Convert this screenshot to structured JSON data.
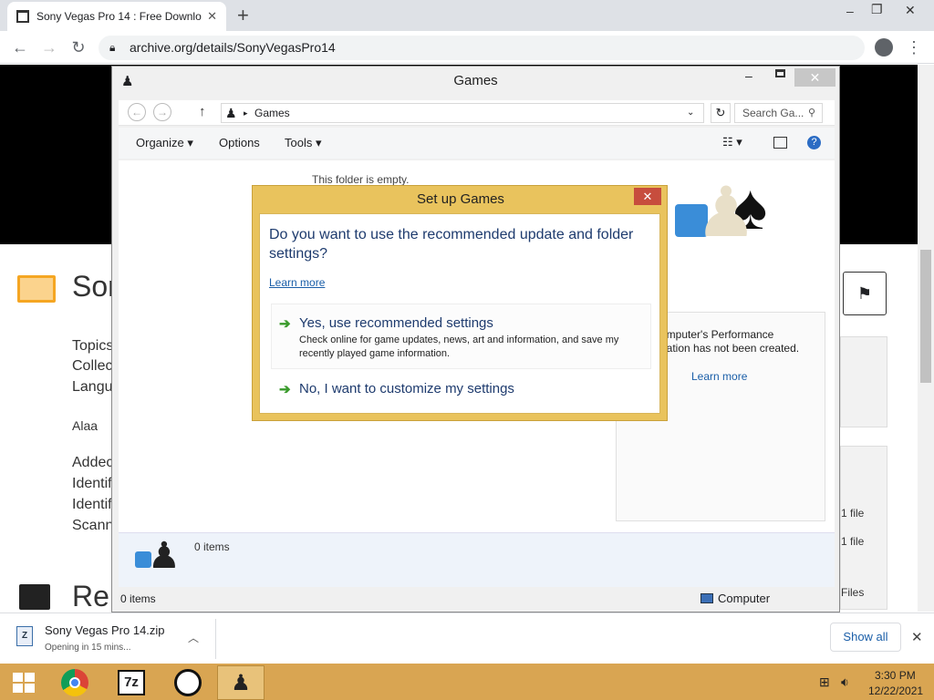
{
  "browser": {
    "tab_title": "Sony Vegas Pro 14 : Free Downlo",
    "new_tab": "+",
    "url": "archive.org/details/SonyVegasPro14",
    "window_controls": [
      "–",
      "❐",
      "✕"
    ]
  },
  "page": {
    "title_fragment": "Sor",
    "meta_labels": [
      "Topics",
      "Collec",
      "Langu",
      "Alaa",
      "Addec",
      "Identif",
      "Identif",
      "Scann"
    ],
    "reviews_fragment": "Re",
    "files": [
      "1 file",
      "1 file",
      "Files"
    ]
  },
  "explorer": {
    "title": "Games",
    "address": "Games",
    "search_placeholder": "Search Ga...",
    "commands": [
      "Organize",
      "Options",
      "Tools"
    ],
    "empty_text": "This folder is empty.",
    "perf_text_1": "omputer's Performance",
    "perf_text_2": "nation has not been created.",
    "perf_link": "Learn more",
    "detail_count": "0 items",
    "status_count": "0 items",
    "status_location": "Computer"
  },
  "dialog": {
    "title": "Set up Games",
    "question": "Do you want to use the recommended update and folder settings?",
    "learn_more": "Learn more",
    "option1_title": "Yes, use recommended settings",
    "option1_desc": "Check online for game updates, news, art and information, and save my recently played game information.",
    "option2_title": "No, I want to customize my settings"
  },
  "download": {
    "filename": "Sony Vegas Pro 14.zip",
    "status": "Opening in 15 mins...",
    "show_all": "Show all"
  },
  "taskbar": {
    "time": "3:30 PM",
    "date": "12/22/2021"
  },
  "colors": {
    "dialog_frame": "#e9c35d",
    "taskbar": "#d9a552",
    "link": "#1a5ea8",
    "close_red": "#c74d3d"
  }
}
